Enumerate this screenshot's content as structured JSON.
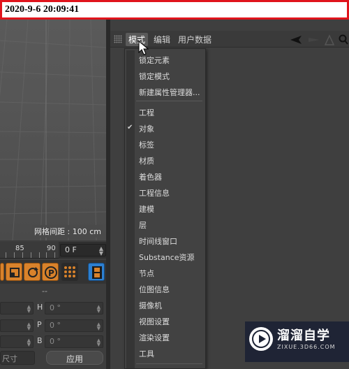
{
  "timestamp": "2020-9-6 20:09:41",
  "viewport": {
    "grid_label": "网格间距 : 100 cm"
  },
  "timeline": {
    "ticks": [
      "85",
      "90"
    ],
    "current_frame": "0 F"
  },
  "attributes": {
    "separator": "--",
    "rows": [
      {
        "letter": "H",
        "value": "0 °"
      },
      {
        "letter": "P",
        "value": "0 °"
      },
      {
        "letter": "B",
        "value": "0 °"
      }
    ],
    "size_dropdown": "尺寸",
    "apply_label": "应用"
  },
  "object_manager": {
    "menu": [
      "模式",
      "编辑",
      "用户数据"
    ]
  },
  "mode_menu": {
    "group1": [
      "锁定元素",
      "锁定模式",
      "新建属性管理器..."
    ],
    "group2": [
      "工程",
      "对象",
      "标签",
      "材质",
      "着色器",
      "工程信息",
      "建模",
      "层",
      "时间线窗口",
      "Substance资源",
      "节点",
      "位图信息",
      "摄像机",
      "视图设置",
      "渲染设置",
      "工具"
    ],
    "checked": "对象"
  },
  "watermark": {
    "title": "溜溜自学",
    "subtitle": "ZIXUE.3D66.COM"
  },
  "colors": {
    "timestamp_border": "#e0141c",
    "accent_orange": "#d9822b",
    "accent_blue": "#2d7fd0"
  }
}
